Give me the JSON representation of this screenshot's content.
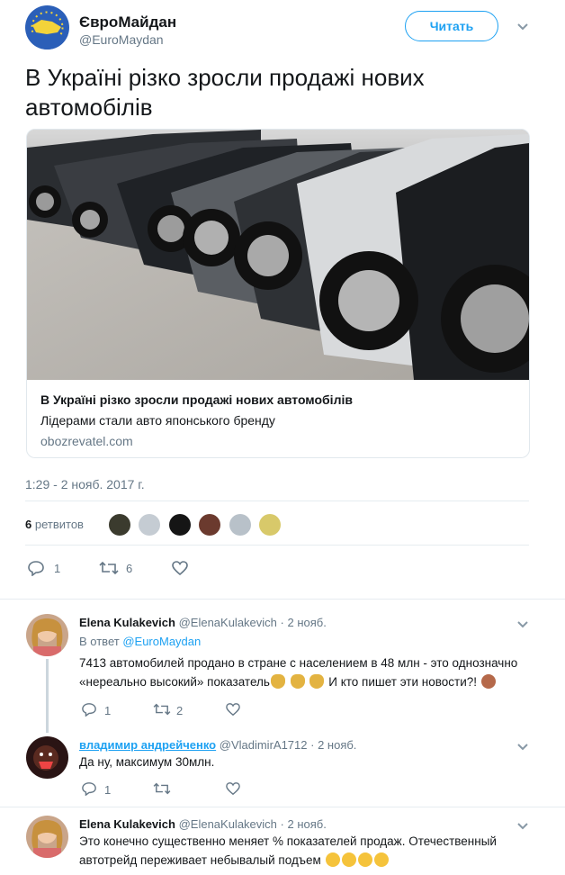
{
  "tweet": {
    "display_name": "ЄвроМайдан",
    "handle": "@EuroMaydan",
    "follow_label": "Читать",
    "text": "В Україні різко зросли продажі нових автомобілів",
    "card": {
      "title": "В Україні різко зросли продажі нових автомобілів",
      "description": "Лідерами стали авто японського бренду",
      "domain": "obozrevatel.com"
    },
    "timestamp": "1:29 - 2 нояб. 2017 г.",
    "retweets_count": "6",
    "retweets_label": "ретвитов",
    "reply_count": "1",
    "retweet_count": "6"
  },
  "replies": [
    {
      "name": "Elena Kulakevich",
      "handle": "@ElenaKulakevich",
      "date": "· 2 нояб.",
      "in_reply_prefix": "В ответ",
      "in_reply_to": "@EuroMaydan",
      "text_line1": "7413 автомобилей продано в стране с населением в 48 млн - это однозначно",
      "text_line2": "«нереально высокий» показатель",
      "text_line2_end": "И кто пишет эти новости?!",
      "reply_count": "1",
      "retweet_count": "2"
    },
    {
      "name": "владимир андрейченко",
      "handle": "@VladimirA1712",
      "date": "· 2 нояб.",
      "text": "Да ну, максимум 30млн.",
      "reply_count": "1"
    },
    {
      "name": "Elena Kulakevich",
      "handle": "@ElenaKulakevich",
      "date": "· 2 нояб.",
      "text_line1": "Это конечно существенно меняет % показателей продаж. Отечественный",
      "text_line2": "автотрейд переживает небывалый подъем"
    }
  ],
  "colors": {
    "accent": "#1da1f2",
    "muted": "#657786",
    "border": "#e6ecf0"
  }
}
